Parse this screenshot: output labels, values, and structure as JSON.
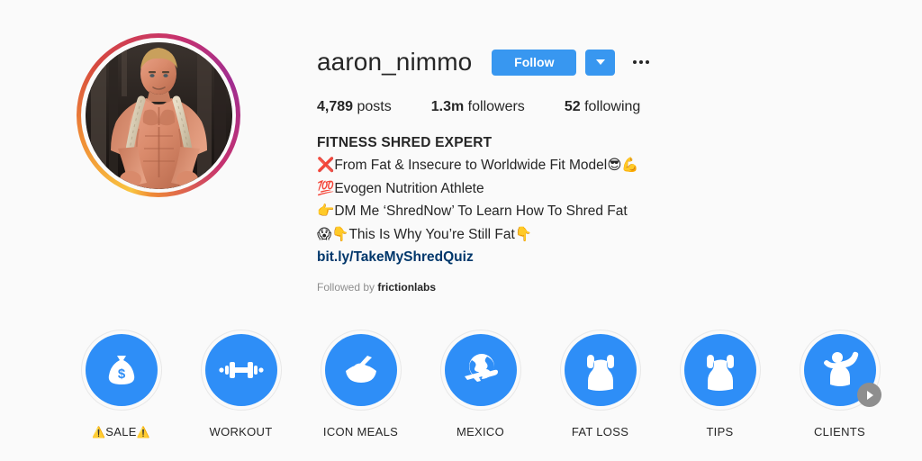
{
  "profile": {
    "username": "aaron_nimmo",
    "avatar_alt": "profile-photo-muscular-man-with-rope",
    "follow_label": "Follow",
    "dropdown_icon": "chevron-down-icon",
    "more_icon": "more-options-icon",
    "stats": [
      {
        "num": "4,789",
        "label": "posts"
      },
      {
        "num": "1.3m",
        "label": "followers"
      },
      {
        "num": "52",
        "label": "following"
      }
    ],
    "bio": {
      "headline": "FITNESS SHRED EXPERT",
      "lines": [
        {
          "prefix": "❌",
          "text": "From Fat & Insecure to Worldwide Fit Model",
          "suffix": "😎💪"
        },
        {
          "prefix": "💯",
          "text": "Evogen Nutrition Athlete",
          "suffix": ""
        },
        {
          "prefix": "👉",
          "text": "DM Me ‘ShredNow’ To Learn How To Shred Fat",
          "suffix": ""
        },
        {
          "prefix": "😱👇",
          "text": "This Is Why You’re Still Fat",
          "suffix": "👇"
        }
      ],
      "link": "bit.ly/TakeMyShredQuiz"
    },
    "followed_by_prefix": "Followed by ",
    "followed_by_name": "frictionlabs"
  },
  "highlights": [
    {
      "label": "SALE",
      "label_prefix": "⚠️",
      "label_suffix": "⚠️",
      "icon": "money-bag-icon"
    },
    {
      "label": "WORKOUT",
      "label_prefix": "",
      "label_suffix": "",
      "icon": "dumbbell-icon"
    },
    {
      "label": "ICON MEALS",
      "label_prefix": "",
      "label_suffix": "",
      "icon": "rice-bowl-icon"
    },
    {
      "label": "MEXICO",
      "label_prefix": "",
      "label_suffix": "",
      "icon": "globe-airplane-icon"
    },
    {
      "label": "FAT LOSS",
      "label_prefix": "",
      "label_suffix": "",
      "icon": "muscle-torso-icon"
    },
    {
      "label": "TIPS",
      "label_prefix": "",
      "label_suffix": "",
      "icon": "muscle-torso-icon"
    },
    {
      "label": "CLIENTS",
      "label_prefix": "",
      "label_suffix": "",
      "icon": "flexing-arm-icon"
    }
  ],
  "next_arrow_icon": "chevron-right-icon",
  "colors": {
    "background": "#fafafa",
    "instagram_blue": "#3897f0",
    "highlight_blue": "#2e8ef7",
    "link_navy": "#00376b",
    "muted_gray": "#8e8e8e",
    "text_dark": "#262626",
    "arrow_gray": "#8e8e8e"
  }
}
